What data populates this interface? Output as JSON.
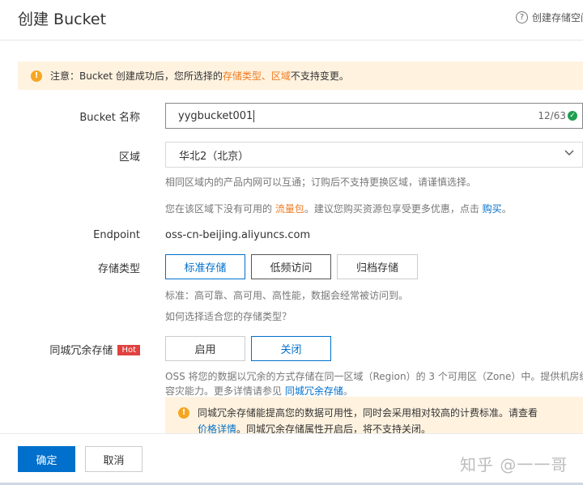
{
  "header": {
    "title": "创建 Bucket",
    "help_icon": "?",
    "help_label": "创建存储空间"
  },
  "notice": {
    "icon": "!",
    "prefix": "注意：Bucket 创建成功后，您所选择的 ",
    "link_storage_type": "存储类型",
    "sep": "、",
    "link_region": "区域",
    "suffix": " 不支持变更。"
  },
  "form": {
    "bucket_name": {
      "label": "Bucket 名称",
      "value": "yygbucket001",
      "counter": "12/63",
      "valid_icon": "✓"
    },
    "region": {
      "label": "区域",
      "value": "华北2（北京）",
      "hint": "相同区域内的产品内网可以互通；订购后不支持更换区域，请谨慎选择。",
      "package_prefix": "您在该区域下没有可用的 ",
      "package_link": "流量包",
      "package_middle": "。建议您购买资源包享受更多优惠，点击 ",
      "buy_link": "购买",
      "package_suffix": "。"
    },
    "endpoint": {
      "label": "Endpoint",
      "value": "oss-cn-beijing.aliyuncs.com"
    },
    "storage_class": {
      "label": "存储类型",
      "options": [
        "标准存储",
        "低频访问",
        "归档存储"
      ],
      "selected": "标准存储",
      "hint": "标准：高可靠、高可用、高性能，数据会经常被访问到。",
      "help_link": "如何选择适合您的存储类型？"
    },
    "redundancy": {
      "label": "同城冗余存储",
      "badge": "Hot",
      "options": [
        "启用",
        "关闭"
      ],
      "selected": "关闭",
      "desc_line1": "OSS 将您的数据以冗余的方式存储在同一区域（Region）的 3 个可用区（Zone）中。提供机房级",
      "desc_line2_prefix": "容灾能力。更多详情请参见 ",
      "desc_link": "同城冗余存储",
      "desc_line2_suffix": "。",
      "info_line1": "同城冗余存储能提高您的数据可用性，同时会采用相对较高的计费标准。请查看",
      "info_link": "价格详情",
      "info_line2_suffix": "。同城冗余存储属性开启后，将不支持关闭。"
    }
  },
  "footer": {
    "confirm": "确定",
    "cancel": "取消",
    "watermark": "知乎 @一一哥"
  },
  "colors": {
    "accent": "#0070cc",
    "warning": "#f5a623",
    "notice_bg": "#fff3e0",
    "hot": "#e0413e",
    "valid": "#1e9e4f"
  }
}
